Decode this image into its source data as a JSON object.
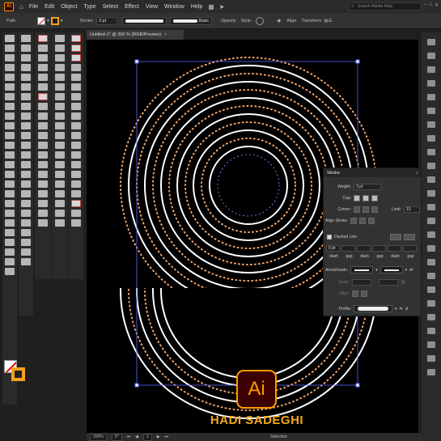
{
  "app": {
    "logo_text": "Ai",
    "menu": [
      "File",
      "Edit",
      "Object",
      "Type",
      "Select",
      "Effect",
      "View",
      "Window",
      "Help"
    ],
    "search_placeholder": "Search Adobe Help"
  },
  "controlbar": {
    "selection_label": "Path",
    "stroke_label": "Stroke:",
    "stroke_value": "3 pt",
    "brush_label": "Basic",
    "opacity_label": "Opacity",
    "style_label": "Style:",
    "align_label": "Align",
    "transform_label": "Transform"
  },
  "document": {
    "tab_title": "Untitled-1* @ 200 % (RGB/Preview)",
    "close": "×"
  },
  "stroke_panel": {
    "title": "Stroke",
    "weight_label": "Weight:",
    "weight_value": "3 pt",
    "cap_label": "Cap:",
    "corner_label": "Corner:",
    "limit_label": "Limit:",
    "limit_value": "10",
    "align_stroke_label": "Align Stroke:",
    "dashed_line_label": "Dashed Line",
    "dash_values": [
      "0 pt",
      "",
      "",
      "",
      "",
      ""
    ],
    "dash_labels": [
      "dash",
      "gap",
      "dash",
      "gap",
      "dash",
      "gap"
    ],
    "arrowheads_label": "Arrowheads:",
    "scale_label": "Scale:",
    "align_label": "Align:",
    "profile_label": "Profile:"
  },
  "statusbar": {
    "zoom": "200%",
    "rotation": "0°",
    "artboard": "1",
    "tool": "Selection"
  },
  "watermark": {
    "logo": "Ai",
    "name": "HADI SADEGHI"
  },
  "colors": {
    "accent": "#f4a11b",
    "canvas": "#000000",
    "dots": "#f2a46a",
    "lines": "#ffffff"
  }
}
